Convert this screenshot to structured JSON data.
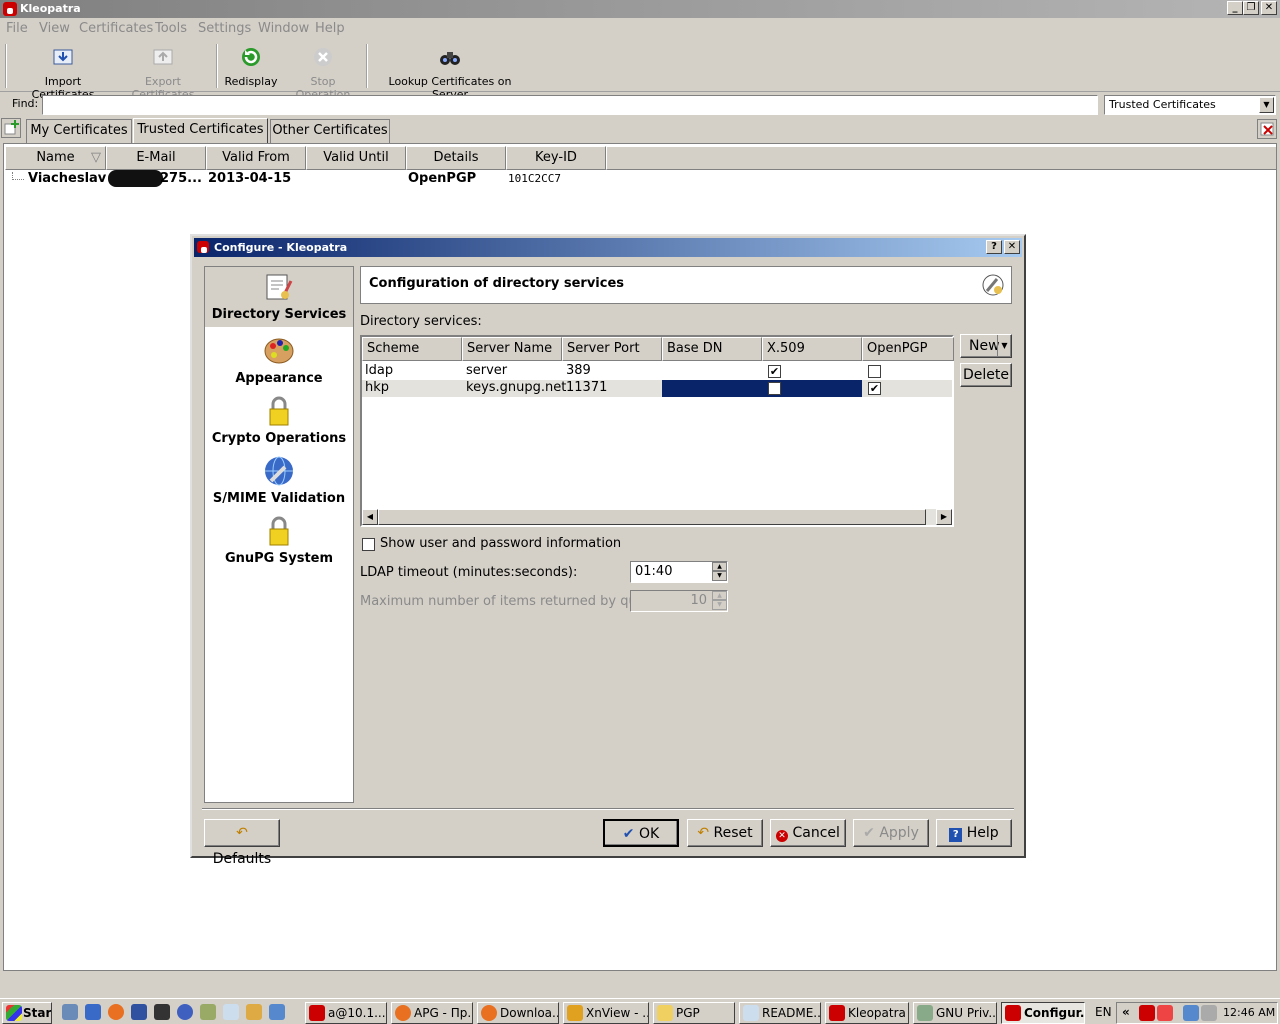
{
  "window": {
    "title": "Kleopatra"
  },
  "menu": [
    "File",
    "View",
    "Certificates",
    "Tools",
    "Settings",
    "Window",
    "Help"
  ],
  "toolbar": {
    "import": "Import Certificates",
    "export": "Export Certificates",
    "redisplay": "Redisplay",
    "stop": "Stop Operation",
    "lookup": "Lookup Certificates on Server"
  },
  "find": {
    "label": "Find:",
    "value": "",
    "filter": "Trusted Certificates"
  },
  "tabs": [
    "My Certificates",
    "Trusted Certificates",
    "Other Certificates"
  ],
  "columns": [
    "Name",
    "E-Mail",
    "Valid From",
    "Valid Until",
    "Details",
    "Key-ID"
  ],
  "certificates": [
    {
      "name": "Viacheslav",
      "email": "275...",
      "valid_from": "2013-04-15",
      "valid_until": "",
      "details": "OpenPGP",
      "key_id": "101C2CC7"
    }
  ],
  "dialog": {
    "title": "Configure - Kleopatra",
    "help_btn": "?",
    "close_btn": "✕",
    "sidebar": [
      "Directory Services",
      "Appearance",
      "Crypto Operations",
      "S/MIME Validation",
      "GnuPG System"
    ],
    "header": "Configuration of directory services",
    "section_label": "Directory services:",
    "table_columns": [
      "Scheme",
      "Server Name",
      "Server Port",
      "Base DN",
      "X.509",
      "OpenPGP"
    ],
    "rows": [
      {
        "scheme": "ldap",
        "server": "server",
        "port": "389",
        "base_dn": "",
        "x509": true,
        "openpgp": false
      },
      {
        "scheme": "hkp",
        "server": "keys.gnupg.net",
        "port": "11371",
        "base_dn": "",
        "x509": false,
        "openpgp": true
      }
    ],
    "new_btn": "New",
    "delete_btn": "Delete",
    "show_user_label": "Show user and password information",
    "ldap_timeout_label": "LDAP timeout (minutes:seconds):",
    "ldap_timeout_value": "01:40",
    "max_items_label": "Maximum number of items returned by query:",
    "max_items_value": "10",
    "buttons": {
      "defaults": "Defaults",
      "ok": "OK",
      "reset": "Reset",
      "cancel": "Cancel",
      "apply": "Apply",
      "help": "Help"
    }
  },
  "taskbar": {
    "start": "Start",
    "tasks": [
      "a@10.1...",
      "APG - Пр...",
      "Downloa...",
      "XnView - ...",
      "PGP",
      "README...",
      "Kleopatra",
      "GNU Priv...",
      "Configur..."
    ],
    "lang": "EN",
    "clock": "12:46 AM"
  },
  "colors": {
    "selection": "#0a246a",
    "title_active": "#0a246a",
    "title_inactive": "#808080",
    "app_red": "#cc0000"
  }
}
